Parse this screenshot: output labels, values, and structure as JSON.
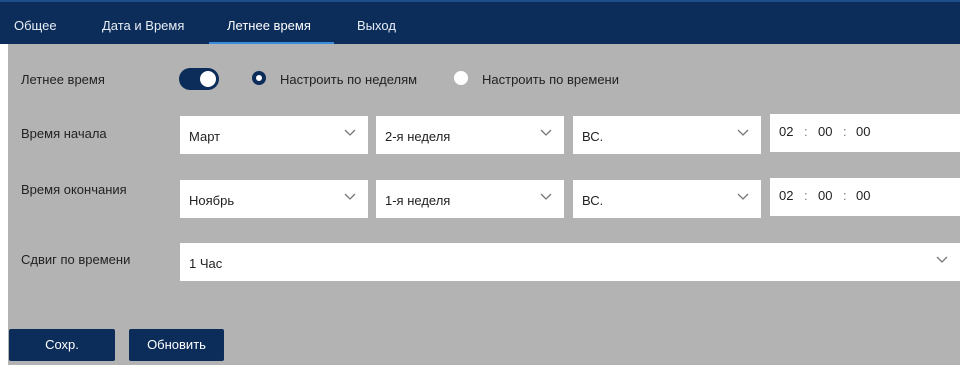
{
  "tabs": [
    {
      "label": "Общее"
    },
    {
      "label": "Дата и Время"
    },
    {
      "label": "Летнее время"
    },
    {
      "label": "Выход"
    }
  ],
  "active_tab": "Летнее время",
  "colors": {
    "navbar": "#0c2d5a",
    "accent": "#3a8ddc",
    "panel_bg": "#b3b3b3",
    "button_bg": "#0c2d5a"
  },
  "dst": {
    "label": "Летнее время",
    "enabled": true,
    "mode_options": [
      {
        "label": "Настроить по неделям",
        "checked": true
      },
      {
        "label": "Настроить по времени",
        "checked": false
      }
    ]
  },
  "start_time": {
    "label": "Время начала",
    "month": "Март",
    "week": "2-я неделя",
    "day": "ВС.",
    "time": {
      "hh": "02",
      "mm": "00",
      "ss": "00"
    }
  },
  "end_time": {
    "label": "Время окончания",
    "month": "Ноябрь",
    "week": "1-я неделя",
    "day": "ВС.",
    "time": {
      "hh": "02",
      "mm": "00",
      "ss": "00"
    }
  },
  "offset": {
    "label": "Сдвиг по времени",
    "value": "1 Час"
  },
  "buttons": {
    "save": "Сохр.",
    "refresh": "Обновить"
  },
  "time_separator": ":"
}
